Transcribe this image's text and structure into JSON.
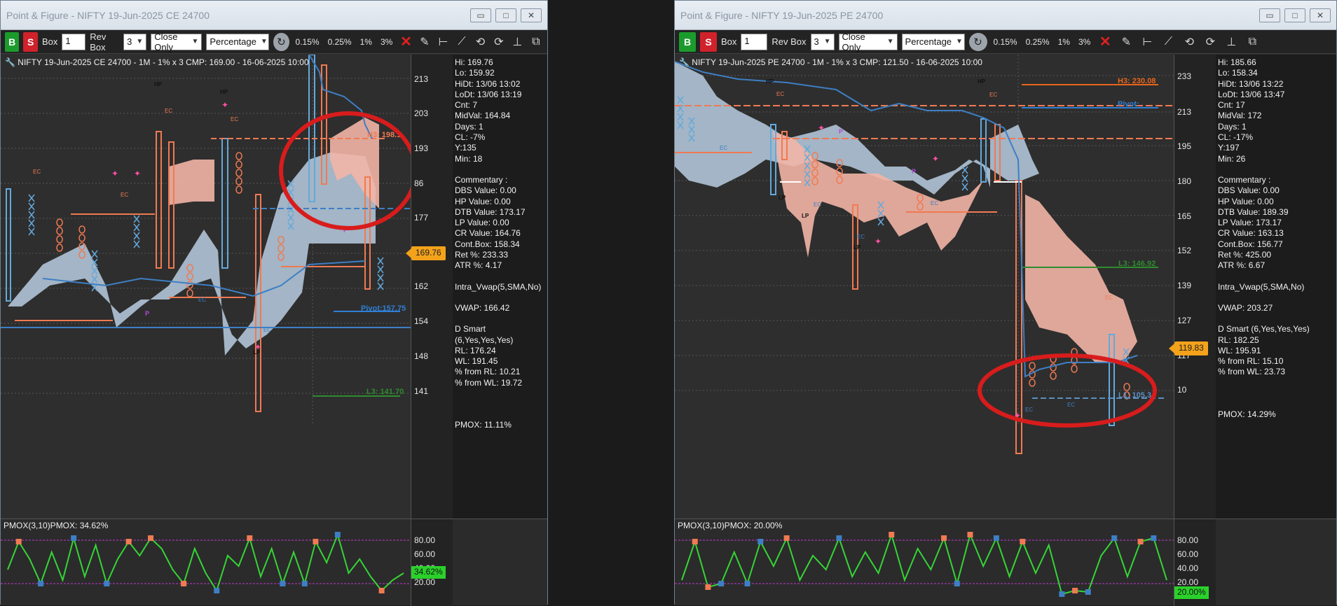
{
  "windows": [
    {
      "title": "Point & Figure - NIFTY 19-Jun-2025 CE 24700",
      "toolbar": {
        "buy": "B",
        "sell": "S",
        "box_label": "Box",
        "box_value": "1",
        "rev_label": "Rev Box",
        "rev_value": "3",
        "mode": "Close Only",
        "scale": "Percentage",
        "pct_buttons": [
          "0.15%",
          "0.25%",
          "1%",
          "3%"
        ]
      },
      "chart_title": "NIFTY 19-Jun-2025 CE 24700 - 1M - 1% x 3 CMP: 169.00 - 16-06-2025 10:00",
      "y_ticks": [
        "213",
        "203",
        "193",
        "86",
        "177",
        "162",
        "154",
        "148",
        "141"
      ],
      "price_tag": "169.76",
      "stats": [
        "Hi: 169.76",
        "Lo: 159.92",
        "HiDt: 13/06 13:02",
        "LoDt: 13/06 13:19",
        "Cnt: 7",
        "MidVal: 164.84",
        "Days: 1",
        "CL: -7%",
        "Y:135",
        "Min: 18"
      ],
      "commentary": [
        "Commentary :",
        "DBS Value:  0.00",
        "HP Value: 0.00",
        "DTB Value: 173.17",
        "LP Value: 0.00",
        "CR Value: 164.76",
        "Cont.Box: 158.34",
        "Ret %: 233.33",
        "ATR %: 4.17"
      ],
      "vwap": [
        "Intra_Vwap(5,SMA,No)",
        "VWAP: 166.42"
      ],
      "dsmart": [
        "D Smart (6,Yes,Yes,Yes)",
        "RL: 176.24",
        "WL: 191.45",
        "% from RL: 10.21",
        "% from WL: 19.72"
      ],
      "pmox_side": "PMOX: 11.11%",
      "levels": {
        "h3": "H3: 198.1",
        "pivot": "Pivot:157.75",
        "l3": "L3: 141.70"
      },
      "pmox_title": "PMOX(3,10)PMOX: 34.62%",
      "pmox_ticks": [
        "80.00",
        "60.00",
        "40.00",
        "20.00"
      ],
      "pmox_tag": "34.62%"
    },
    {
      "title": "Point & Figure - NIFTY 19-Jun-2025 PE 24700",
      "toolbar": {
        "buy": "B",
        "sell": "S",
        "box_label": "Box",
        "box_value": "1",
        "rev_label": "Rev Box",
        "rev_value": "3",
        "mode": "Close Only",
        "scale": "Percentage",
        "pct_buttons": [
          "0.15%",
          "0.25%",
          "1%",
          "3%"
        ]
      },
      "chart_title": "NIFTY 19-Jun-2025 PE 24700 - 1M - 1% x 3 CMP: 121.50 - 16-06-2025 10:00",
      "y_ticks": [
        "233",
        "213",
        "195",
        "180",
        "165",
        "152",
        "139",
        "127",
        "117",
        "10"
      ],
      "price_tag": "119.83",
      "stats": [
        "Hi: 185.66",
        "Lo: 158.34",
        "HiDt: 13/06 13:22",
        "LoDt: 13/06 13:47",
        "Cnt: 17",
        "MidVal: 172",
        "Days: 1",
        "CL: -17%",
        "Y:197",
        "Min: 26"
      ],
      "commentary": [
        "Commentary :",
        "DBS Value:  0.00",
        "HP Value: 0.00",
        "DTB Value: 189.39",
        "LP Value: 173.17",
        "CR Value: 163.13",
        "Cont.Box: 156.77",
        "Ret %: 425.00",
        "ATR %: 6.67"
      ],
      "vwap": [
        "Intra_Vwap(5,SMA,No)",
        "VWAP: 203.27"
      ],
      "dsmart": [
        "D Smart (6,Yes,Yes,Yes)",
        "RL: 182.25",
        "WL: 195.91",
        "% from RL: 15.10",
        "% from WL: 23.73"
      ],
      "pmox_side": "PMOX: 14.29%",
      "levels": {
        "h3": "H3: 230.08",
        "pivot": "Pivot:",
        "l3": "L3: 146.92",
        "l1": "L1: 105.34"
      },
      "pmox_title": "PMOX(3,10)PMOX: 20.00%",
      "pmox_ticks": [
        "80.00",
        "60.00",
        "40.00",
        "20.00"
      ],
      "pmox_tag": "20.00%"
    }
  ],
  "markers": {
    "hp": "HP",
    "lp": "LP",
    "ec": "EC",
    "p": "P"
  },
  "pmox_series": [
    [
      40,
      80,
      55,
      20,
      65,
      25,
      85,
      30,
      75,
      20,
      55,
      80,
      60,
      85,
      70,
      40,
      20,
      70,
      35,
      10,
      60,
      45,
      85,
      30,
      70,
      20,
      65,
      20,
      80,
      50,
      90,
      35,
      55,
      30,
      10,
      25,
      35
    ],
    [
      25,
      80,
      15,
      20,
      65,
      20,
      80,
      45,
      85,
      25,
      60,
      40,
      85,
      30,
      65,
      35,
      90,
      25,
      70,
      40,
      85,
      20,
      90,
      45,
      85,
      30,
      80,
      35,
      75,
      5,
      10,
      8,
      60,
      85,
      30,
      80,
      85,
      25
    ]
  ],
  "colors": {
    "x_col": "#64a9dc",
    "o_col": "#f07a52",
    "cloud_blue": "#b7cde0",
    "cloud_red": "#f2b5a6",
    "ellipse": "#d81c1c",
    "pmox_line": "#35d535"
  }
}
